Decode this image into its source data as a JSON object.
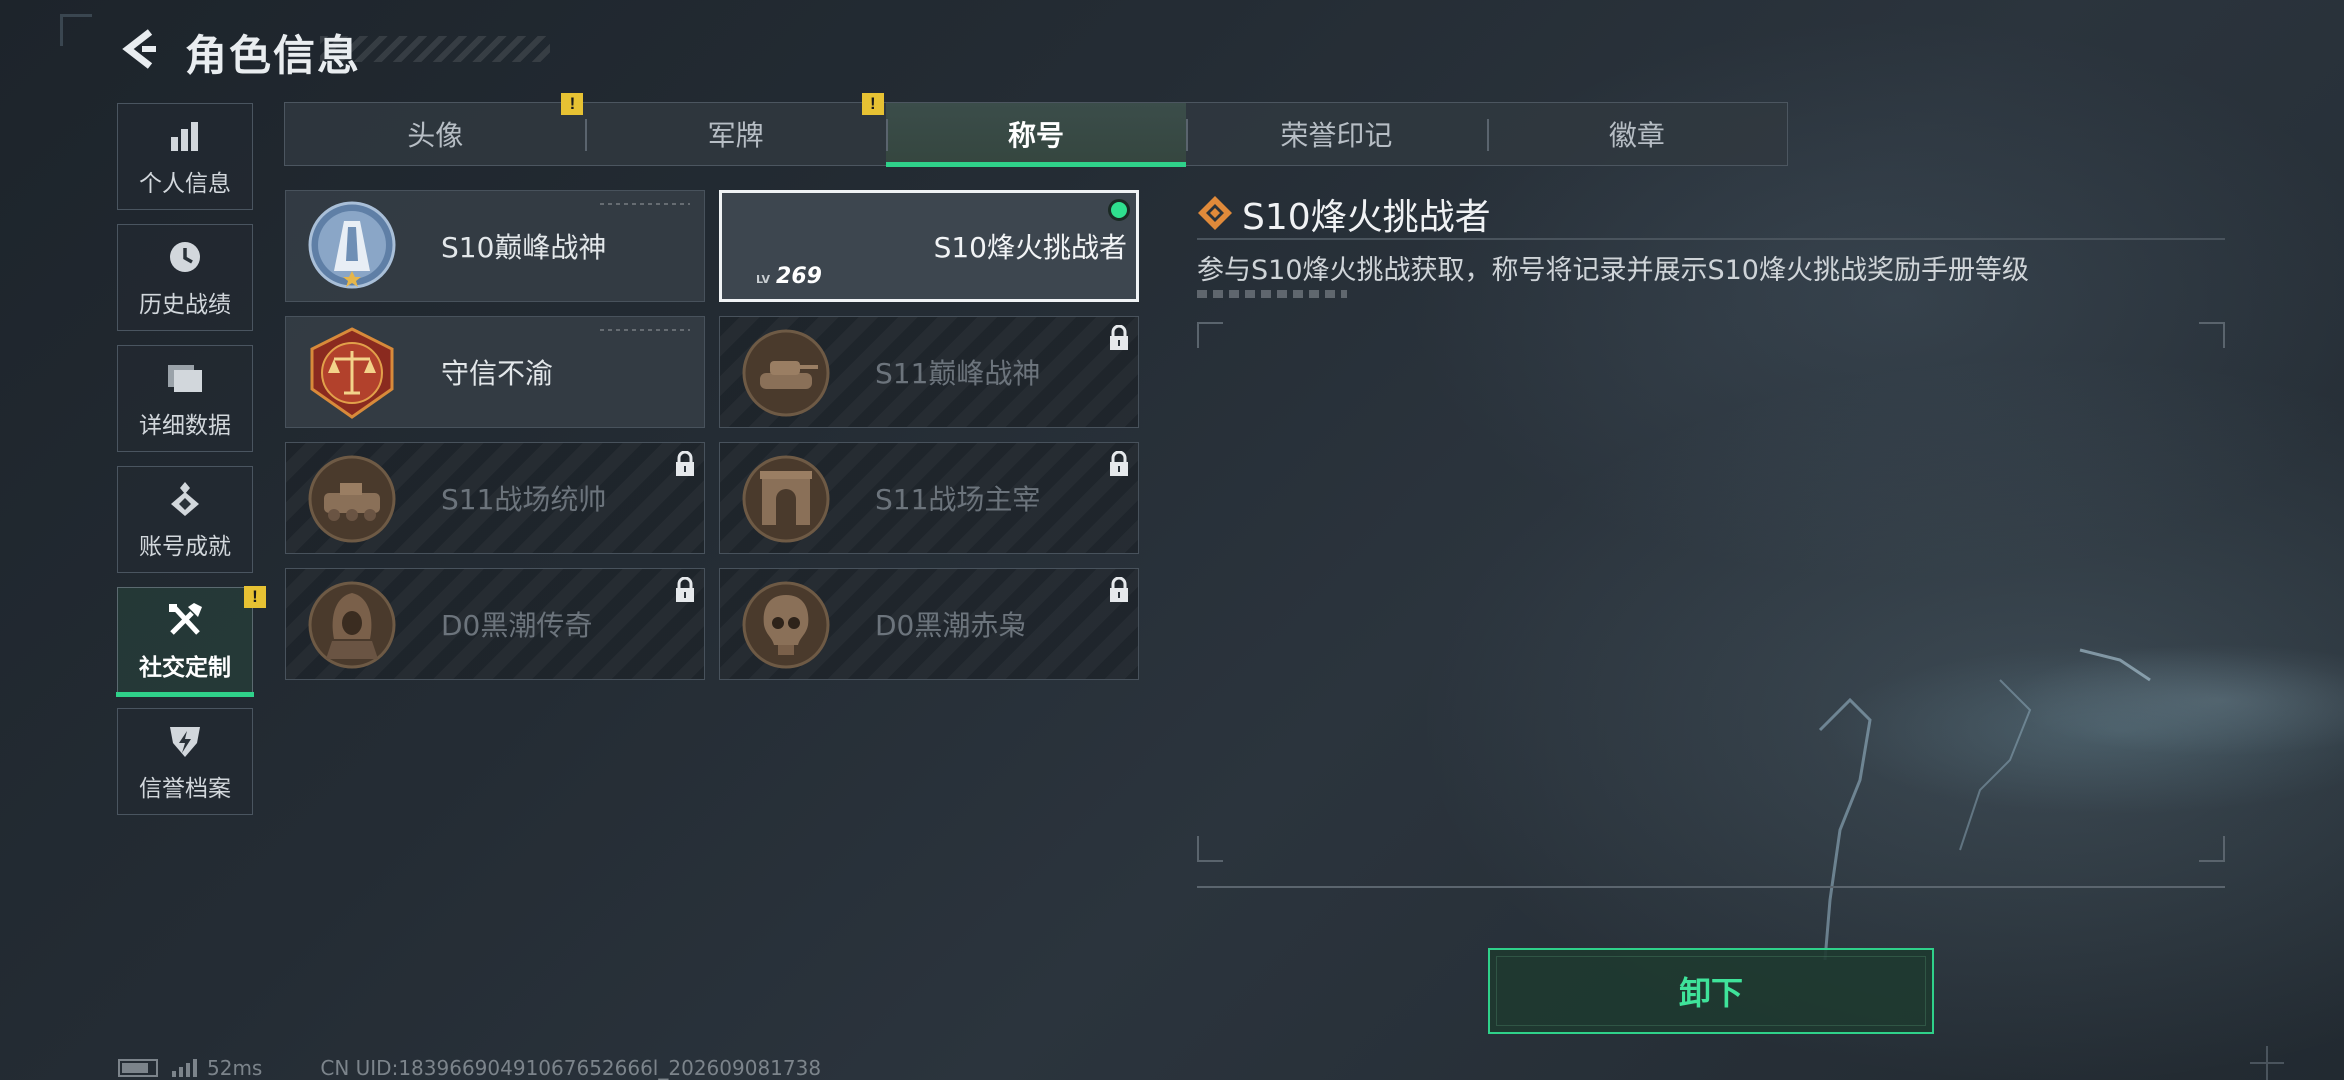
{
  "header": {
    "title": "角色信息"
  },
  "sidebar": {
    "items": [
      {
        "label": "个人信息",
        "icon": "bar-chart-icon"
      },
      {
        "label": "历史战绩",
        "icon": "history-clock-icon"
      },
      {
        "label": "详细数据",
        "icon": "folder-icon"
      },
      {
        "label": "账号成就",
        "icon": "achievement-icon"
      },
      {
        "label": "社交定制",
        "icon": "tools-icon",
        "active": true,
        "alert": "!"
      },
      {
        "label": "信誉档案",
        "icon": "credit-shield-icon"
      }
    ]
  },
  "tabs": [
    {
      "label": "头像",
      "alert": "!"
    },
    {
      "label": "军牌",
      "alert": "!"
    },
    {
      "label": "称号",
      "active": true
    },
    {
      "label": "荣誉印记"
    },
    {
      "label": "徽章"
    }
  ],
  "titles": [
    {
      "name": "S10巅峰战神",
      "badge": "peak-warrior-s10-badge",
      "locked": false
    },
    {
      "name": "S10烽火挑战者",
      "badge": "none",
      "selected": true,
      "equipped": true,
      "level_prefix": "LV",
      "level": "269"
    },
    {
      "name": "守信不渝",
      "badge": "scales-justice-badge",
      "locked": false
    },
    {
      "name": "S11巅峰战神",
      "badge": "tank-badge",
      "locked": true
    },
    {
      "name": "S11战场统帅",
      "badge": "armored-vehicle-badge",
      "locked": true
    },
    {
      "name": "S11战场主宰",
      "badge": "arch-badge",
      "locked": true
    },
    {
      "name": "D0黑潮传奇",
      "badge": "hooded-figure-badge",
      "locked": true
    },
    {
      "name": "D0黑潮赤枭",
      "badge": "skull-badge",
      "locked": true
    }
  ],
  "detail": {
    "title": "S10烽火挑战者",
    "description": "参与S10烽火挑战获取，称号将记录并展示S10烽火挑战奖励手册等级"
  },
  "actions": {
    "unequip_label": "卸下"
  },
  "footer": {
    "ping": "52ms",
    "uid": "CN UID:18396690491067652666l_202609081738"
  },
  "colors": {
    "accent_green": "#2fd18a",
    "alert_yellow": "#e7c233",
    "detail_icon_orange": "#e08a3a"
  }
}
